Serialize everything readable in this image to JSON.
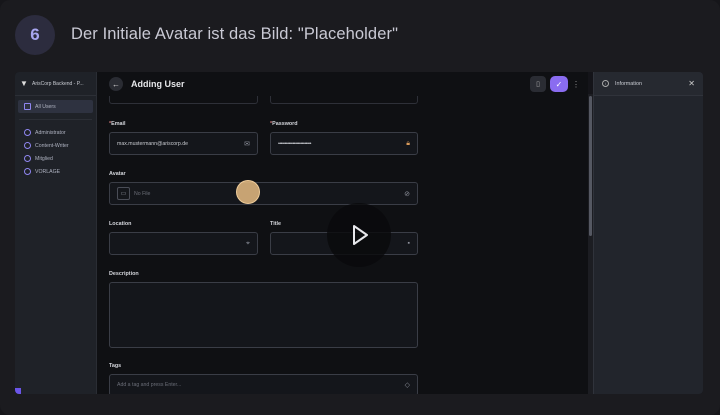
{
  "step": {
    "number": "6",
    "title": "Der Initiale Avatar ist das Bild: \"Placeholder\""
  },
  "sidebar": {
    "app_name": "ArisCorp Backend - P...",
    "items": [
      {
        "label": "All Users",
        "selected": true
      },
      {
        "label": "Administrator"
      },
      {
        "label": "Content-Writer"
      },
      {
        "label": "Mitglied"
      },
      {
        "label": "VORLAGE"
      }
    ]
  },
  "header": {
    "title": "Adding User"
  },
  "form": {
    "email": {
      "label": "Email",
      "value": "max.mustermann@ariscorp.de"
    },
    "password": {
      "label": "Password",
      "value": "•••••••••••••••••••••••••"
    },
    "avatar": {
      "label": "Avatar",
      "placeholder": "No File"
    },
    "location": {
      "label": "Location"
    },
    "title": {
      "label": "Title"
    },
    "description": {
      "label": "Description"
    },
    "tags": {
      "label": "Tags",
      "placeholder": "Add a tag and press Enter..."
    }
  },
  "info_panel": {
    "title": "Information"
  },
  "colors": {
    "accent": "#8a6cf0",
    "badge_text": "#a8a6ef",
    "cursor": "#e6bc82"
  }
}
